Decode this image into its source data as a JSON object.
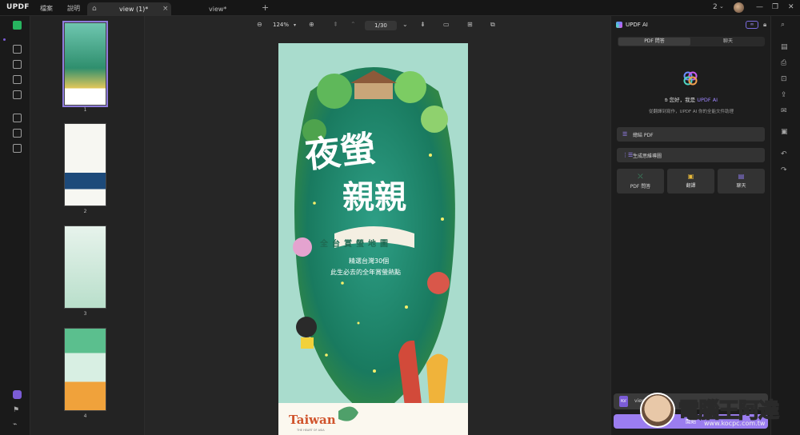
{
  "titlebar": {
    "logo": "UPDF",
    "menus": [
      "檔案",
      "說明"
    ],
    "tabs": [
      {
        "label": "view (1)*",
        "active": true
      },
      {
        "label": "view*",
        "active": false
      }
    ],
    "page_count_badge": "2",
    "window_buttons": [
      "minimize",
      "restore",
      "close"
    ]
  },
  "toolbar": {
    "zoom": "124%",
    "page_current": "1",
    "page_total": "30"
  },
  "thumbnails": [
    {
      "number": "1",
      "selected": true
    },
    {
      "number": "2",
      "selected": false
    },
    {
      "number": "3",
      "selected": false
    },
    {
      "number": "4",
      "selected": false
    }
  ],
  "poster": {
    "title_line1": "夜螢",
    "title_line2": "親親",
    "banner": "全台賞螢地圖",
    "subtitle_line1": "精選台灣30個",
    "subtitle_line2": "此生必去的全年賞螢熱點",
    "brand": "Taiwan",
    "brand_tagline": "THE HEART OF ASIA"
  },
  "ai_panel": {
    "title": "UPDF AI",
    "header_button": "∞",
    "segments": [
      "PDF 問答",
      "聊天"
    ],
    "greeting_prefix": "您好，我是",
    "greeting_name": "UPDF AI",
    "subtitle": "從翻譯到寫作，UPDF AI 你的全能文件助理",
    "actions": [
      {
        "label": "總結 PDF",
        "icon": "☰"
      },
      {
        "label": "生成思維導圖",
        "icon": "⋮☰"
      }
    ],
    "cards": [
      {
        "label": "PDF 問答",
        "icon": "⤫",
        "color": "#3fbf7f"
      },
      {
        "label": "翻譯",
        "icon": "▣",
        "color": "#e8b93a"
      },
      {
        "label": "聊天",
        "icon": "▤",
        "color": "#8f7bf0"
      }
    ],
    "chat_file": "view",
    "send_label": "開始"
  },
  "watermark": {
    "text": "電腦王阿達",
    "url": "www.kocpc.com.tw"
  }
}
